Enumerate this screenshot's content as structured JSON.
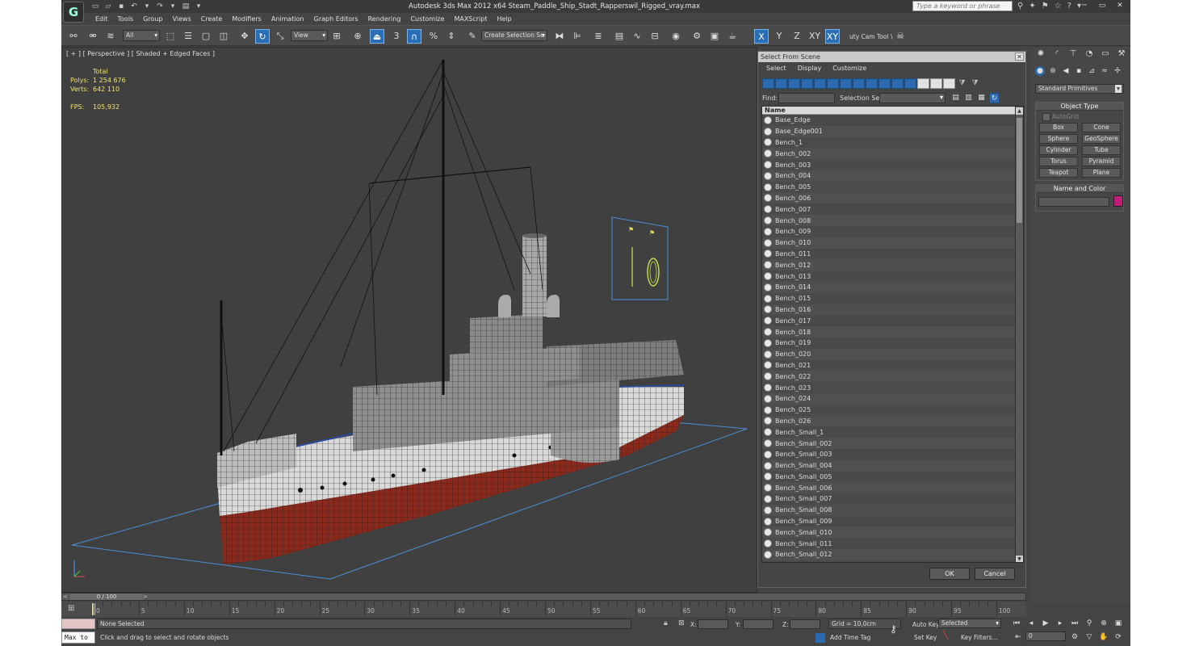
{
  "window": {
    "title": "Autodesk 3ds Max  2012 x64     Steam_Paddle_Ship_Stadt_Rapperswil_Rigged_vray.max",
    "search_placeholder": "Type a keyword or phrase"
  },
  "menu": [
    "Edit",
    "Tools",
    "Group",
    "Views",
    "Create",
    "Modifiers",
    "Animation",
    "Graph Editors",
    "Rendering",
    "Customize",
    "MAXScript",
    "Help"
  ],
  "toolbar": {
    "filter": "All",
    "ref_coord": "View",
    "selection_set": "Create Selection Se",
    "snap_number": "3",
    "axes": [
      "X",
      "Y",
      "Z",
      "XY",
      "XY"
    ],
    "cam_tool": "uty Cam Tool \\"
  },
  "viewport": {
    "label": "[ + ] [ Perspective ] [ Shaded + Edged Faces ]",
    "stats_header": "Total",
    "polys_label": "Polys:",
    "polys_value": "1 254 676",
    "verts_label": "Verts:",
    "verts_value": "642 110",
    "fps_label": "FPS:",
    "fps_value": "105,932"
  },
  "dialog": {
    "title": "Select From Scene",
    "menu": [
      "Select",
      "Display",
      "Customize"
    ],
    "find_label": "Find:",
    "selection_set_label": "Selection Set:",
    "column_header": "Name",
    "items": [
      "Base_Edge",
      "Base_Edge001",
      "Bench_1",
      "Bench_002",
      "Bench_003",
      "Bench_004",
      "Bench_005",
      "Bench_006",
      "Bench_007",
      "Bench_008",
      "Bench_009",
      "Bench_010",
      "Bench_011",
      "Bench_012",
      "Bench_013",
      "Bench_014",
      "Bench_015",
      "Bench_016",
      "Bench_017",
      "Bench_018",
      "Bench_019",
      "Bench_020",
      "Bench_021",
      "Bench_022",
      "Bench_023",
      "Bench_024",
      "Bench_025",
      "Bench_026",
      "Bench_Small_1",
      "Bench_Small_002",
      "Bench_Small_003",
      "Bench_Small_004",
      "Bench_Small_005",
      "Bench_Small_006",
      "Bench_Small_007",
      "Bench_Small_008",
      "Bench_Small_009",
      "Bench_Small_010",
      "Bench_Small_011",
      "Bench_Small_012"
    ],
    "ok": "OK",
    "cancel": "Cancel"
  },
  "command_panel": {
    "category": "Standard Primitives",
    "object_type_header": "Object Type",
    "autogrid": "AutoGrid",
    "buttons": [
      "Box",
      "Cone",
      "Sphere",
      "GeoSphere",
      "Cylinder",
      "Tube",
      "Torus",
      "Pyramid",
      "Teapot",
      "Plane"
    ],
    "name_color_header": "Name and Color",
    "object_color": "#c21c7a"
  },
  "timeline": {
    "position": "0 / 100",
    "ticks": [
      "0",
      "5",
      "10",
      "15",
      "20",
      "25",
      "30",
      "35",
      "40",
      "45",
      "50",
      "55",
      "60",
      "65",
      "70",
      "75",
      "80",
      "85",
      "90",
      "95",
      "100"
    ]
  },
  "status": {
    "maxscript": "Max to",
    "selection": "None Selected",
    "prompt": "Click and drag to select and rotate objects",
    "x_label": "X:",
    "y_label": "Y:",
    "z_label": "Z:",
    "grid": "Grid = 10,0cm",
    "add_time_tag": "Add Time Tag",
    "auto_key": "Auto Key",
    "set_key": "Set Key",
    "key_mode": "Selected",
    "key_filters": "Key Filters...",
    "frame": "0"
  }
}
